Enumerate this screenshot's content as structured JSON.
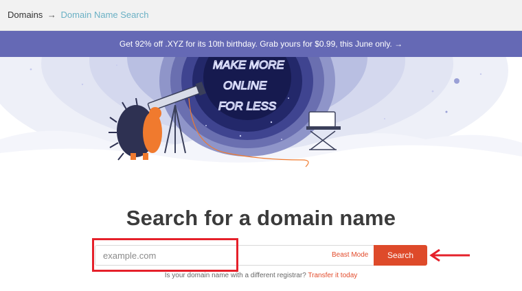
{
  "breadcrumb": {
    "root": "Domains",
    "separator": "→",
    "current": "Domain Name Search"
  },
  "promo": {
    "text": "Get 92% off .XYZ for its 10th birthday. Grab yours for $0.99, this June only. →"
  },
  "hero": {
    "lettering": [
      "MAKE MORE",
      "ONLINE",
      "FOR LESS"
    ]
  },
  "search": {
    "heading": "Search for a domain name",
    "placeholder": "example.com",
    "beast_mode_label": "Beast Mode",
    "search_button_label": "Search",
    "registrar_question": "Is your domain name with a different registrar?",
    "transfer_link": "Transfer it today"
  },
  "colors": {
    "promo_bar": "#6569b5",
    "accent": "#de4a2a",
    "breadcrumb_link": "#6ab0c4",
    "annotation": "#e5202a"
  },
  "icons": [
    "right-arrow-icon",
    "red-pointer-arrow-icon"
  ]
}
